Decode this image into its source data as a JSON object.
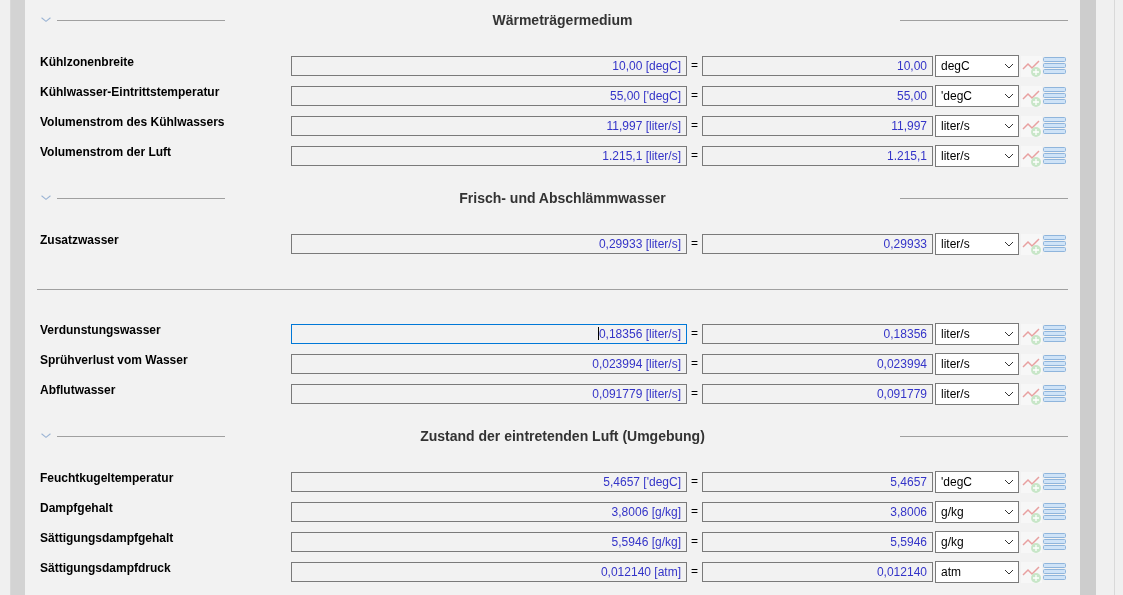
{
  "sections": [
    {
      "title": "Wärmeträgermedium",
      "expanded": true,
      "items": [
        {
          "kind": "row",
          "label": "Kühlzonenbreite",
          "value": "10,00 [degC]",
          "operator": "=",
          "result": "10,00",
          "unit": "degC",
          "focused": false
        },
        {
          "kind": "row",
          "label": "Kühlwasser-Eintrittstemperatur",
          "value": "55,00 ['degC]",
          "operator": "=",
          "result": "55,00",
          "unit": "'degC",
          "focused": false
        },
        {
          "kind": "row",
          "label": "Volumenstrom des Kühlwassers",
          "value": "11,997 [liter/s]",
          "operator": "=",
          "result": "11,997",
          "unit": "liter/s",
          "focused": false
        },
        {
          "kind": "row",
          "label": "Volumenstrom der Luft",
          "value": "1.215,1 [liter/s]",
          "operator": "=",
          "result": "1.215,1",
          "unit": "liter/s",
          "focused": false
        }
      ]
    },
    {
      "title": "Frisch- und Abschlämmwasser",
      "expanded": true,
      "items": [
        {
          "kind": "row",
          "label": "Zusatzwasser",
          "value": "0,29933 [liter/s]",
          "operator": "=",
          "result": "0,29933",
          "unit": "liter/s",
          "focused": false
        },
        {
          "kind": "separator"
        },
        {
          "kind": "row",
          "label": "Verdunstungswasser",
          "value": "0,18356 [liter/s]",
          "operator": "=",
          "result": "0,18356",
          "unit": "liter/s",
          "focused": true
        },
        {
          "kind": "row",
          "label": "Sprühverlust vom Wasser",
          "value": "0,023994 [liter/s]",
          "operator": "=",
          "result": "0,023994",
          "unit": "liter/s",
          "focused": false
        },
        {
          "kind": "row",
          "label": "Abflutwasser",
          "value": "0,091779 [liter/s]",
          "operator": "=",
          "result": "0,091779",
          "unit": "liter/s",
          "focused": false
        }
      ]
    },
    {
      "title": "Zustand der eintretenden Luft (Umgebung)",
      "expanded": true,
      "items": [
        {
          "kind": "row",
          "label": "Feuchtkugeltemperatur",
          "value": "5,4657 ['degC]",
          "operator": "=",
          "result": "5,4657",
          "unit": "'degC",
          "focused": false
        },
        {
          "kind": "row",
          "label": "Dampfgehalt",
          "value": "3,8006 [g/kg]",
          "operator": "=",
          "result": "3,8006",
          "unit": "g/kg",
          "focused": false
        },
        {
          "kind": "row",
          "label": "Sättigungsdampfgehalt",
          "value": "5,5946 [g/kg]",
          "operator": "=",
          "result": "5,5946",
          "unit": "g/kg",
          "focused": false
        },
        {
          "kind": "row",
          "label": "Sättigungsdampfdruck",
          "value": "0,012140 [atm]",
          "operator": "=",
          "result": "0,012140",
          "unit": "atm",
          "focused": false
        }
      ]
    }
  ]
}
